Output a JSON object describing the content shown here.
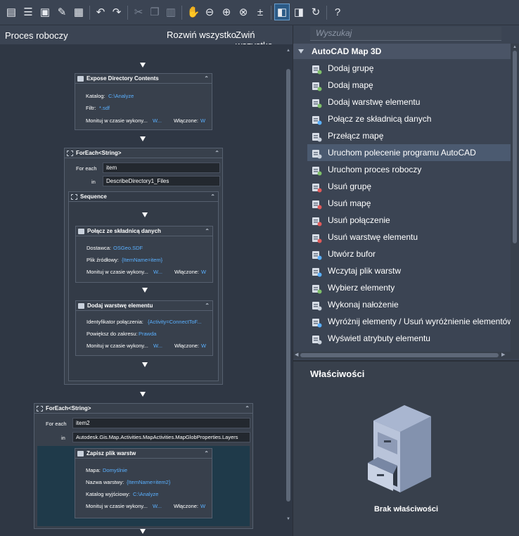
{
  "toolbar": {
    "buttons": [
      "new-workflow",
      "open-workflow",
      "save",
      "save-as",
      "save-all",
      "undo",
      "redo",
      "cut",
      "copy",
      "paste",
      "pan",
      "zoom-out",
      "zoom-in",
      "zoom-fit",
      "zoom-reset",
      "toggle-catalog",
      "toggle-properties",
      "refresh",
      "help"
    ]
  },
  "left": {
    "title": "Proces roboczy",
    "expand_all": "Rozwiń wszystko",
    "collapse_all": "Zwiń wszystko"
  },
  "workflow": {
    "expose": {
      "title": "Expose Directory Contents",
      "catalog_label": "Katalog:",
      "catalog_value": "C:\\Analyze",
      "filter_label": "Filtr:",
      "filter_value": "*.sdf",
      "monitor_label": "Monituj w czasie wykony...",
      "monitor_value": "W...",
      "enabled_label": "Włączone:",
      "enabled_value": "W"
    },
    "foreach1": {
      "title": "ForEach<String>",
      "foreach_label": "For each",
      "foreach_value": "item",
      "in_label": "in",
      "in_value": "DescribeDirectory1_Files",
      "sequence_title": "Sequence",
      "connect": {
        "title": "Połącz ze składnicą danych",
        "provider_label": "Dostawca:",
        "provider_value": "OSGeo.SDF",
        "source_label": "Plik źródłowy:",
        "source_value": "{ItemName=item}",
        "monitor_label": "Monituj w czasie wykony...",
        "monitor_value": "W...",
        "enabled_label": "Włączone:",
        "enabled_value": "W"
      },
      "addlayer": {
        "title": "Dodaj warstwę elementu",
        "conn_label": "Identyfikator połączenia:",
        "conn_value": "{Activity=ConnectToF...",
        "zoom_label": "Powiększ do zakresu:",
        "zoom_value": "Prawda",
        "monitor_label": "Monituj w czasie wykony...",
        "monitor_value": "W...",
        "enabled_label": "Włączone:",
        "enabled_value": "W"
      }
    },
    "foreach2": {
      "title": "ForEach<String>",
      "foreach_label": "For each",
      "foreach_value": "item2",
      "in_label": "in",
      "in_value": "Autodesk.Gis.Map.Activities.MapActivities.MapGlobProperties.Layers",
      "save": {
        "title": "Zapisz plik warstw",
        "map_label": "Mapa:",
        "map_value": "Domyślnie",
        "layer_label": "Nazwa warstwy:",
        "layer_value": "{ItemName=item2}",
        "out_label": "Katalog wyjściowy:",
        "out_value": "C:\\Analyze",
        "monitor_label": "Monituj w czasie wykony...",
        "monitor_value": "W...",
        "enabled_label": "Włączone:",
        "enabled_value": "W"
      }
    }
  },
  "search": {
    "placeholder": "Wyszukaj"
  },
  "catalog": {
    "group": "AutoCAD Map 3D",
    "items": [
      {
        "label": "Dodaj grupę",
        "icon": "add-group-icon"
      },
      {
        "label": "Dodaj mapę",
        "icon": "add-map-icon"
      },
      {
        "label": "Dodaj warstwę elementu",
        "icon": "add-layer-icon"
      },
      {
        "label": "Połącz ze składnicą danych",
        "icon": "connect-icon"
      },
      {
        "label": "Przełącz mapę",
        "icon": "switch-map-icon"
      },
      {
        "label": "Uruchom polecenie programu AutoCAD",
        "icon": "run-command-icon"
      },
      {
        "label": "Uruchom proces roboczy",
        "icon": "run-workflow-icon"
      },
      {
        "label": "Usuń grupę",
        "icon": "remove-group-icon"
      },
      {
        "label": "Usuń mapę",
        "icon": "remove-map-icon"
      },
      {
        "label": "Usuń połączenie",
        "icon": "remove-connection-icon"
      },
      {
        "label": "Usuń warstwę elementu",
        "icon": "remove-layer-icon"
      },
      {
        "label": "Utwórz bufor",
        "icon": "buffer-icon"
      },
      {
        "label": "Wczytaj plik warstw",
        "icon": "load-layer-icon"
      },
      {
        "label": "Wybierz elementy",
        "icon": "select-features-icon"
      },
      {
        "label": "Wykonaj nałożenie",
        "icon": "overlay-icon"
      },
      {
        "label": "Wyróżnij elementy / Usuń wyróżnienie elementów",
        "icon": "highlight-icon"
      },
      {
        "label": "Wyświetl atrybuty elementu",
        "icon": "attributes-icon"
      }
    ]
  },
  "properties": {
    "title": "Właściwości",
    "empty": "Brak właściwości"
  }
}
